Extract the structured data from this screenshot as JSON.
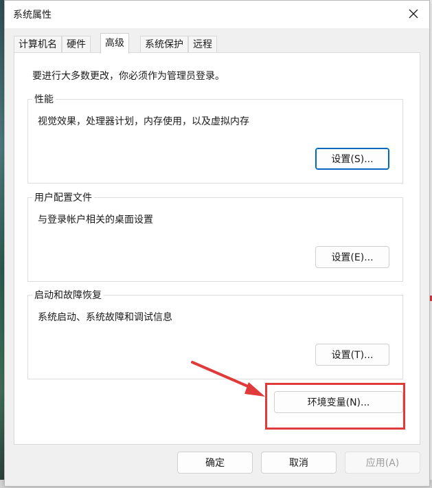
{
  "window": {
    "title": "系统属性"
  },
  "tabs": [
    {
      "label": "计算机名",
      "active": false
    },
    {
      "label": "硬件",
      "active": false
    },
    {
      "label": "高级",
      "active": true
    },
    {
      "label": "系统保护",
      "active": false
    },
    {
      "label": "远程",
      "active": false
    }
  ],
  "notice": "要进行大多数更改，你必须作为管理员登录。",
  "groups": {
    "performance": {
      "label": "性能",
      "description": "视觉效果，处理器计划，内存使用，以及虚拟内存",
      "button": "设置(S)..."
    },
    "profiles": {
      "label": "用户配置文件",
      "description": "与登录帐户相关的桌面设置",
      "button": "设置(E)..."
    },
    "startup": {
      "label": "启动和故障恢复",
      "description": "系统启动、系统故障和调试信息",
      "button": "设置(T)..."
    }
  },
  "env_button": "环境变量(N)...",
  "footer": {
    "ok": "确定",
    "cancel": "取消",
    "apply": "应用(A)"
  },
  "icons": {
    "close": "close-icon"
  },
  "colors": {
    "annotation": "#e03a3a",
    "focus": "#0067c0"
  }
}
